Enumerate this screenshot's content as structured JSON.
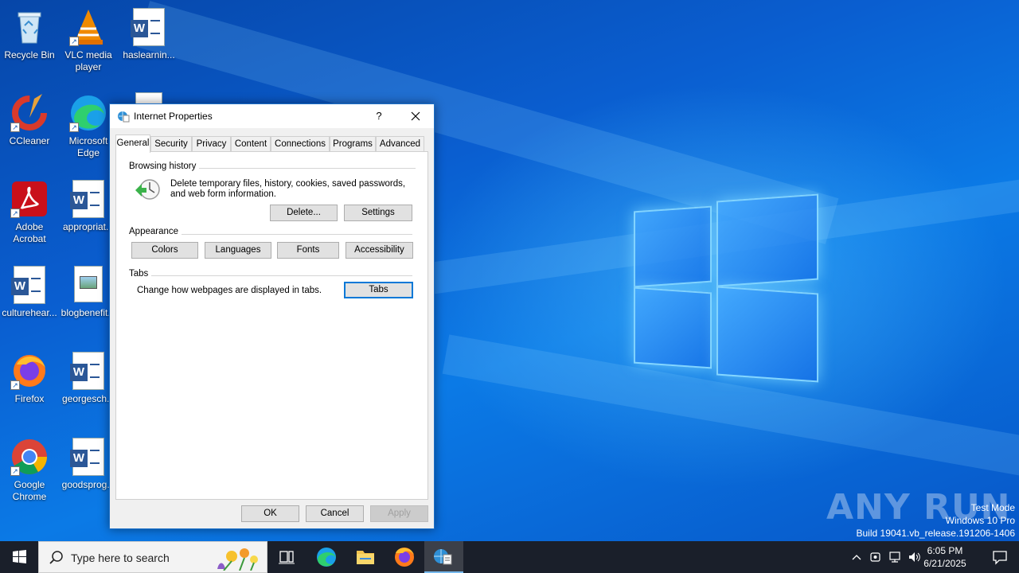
{
  "desktop": {
    "icons": [
      {
        "label": "Recycle Bin"
      },
      {
        "label": "VLC media player"
      },
      {
        "label": "haslearnin..."
      },
      {
        "label": "CCleaner"
      },
      {
        "label": "Microsoft Edge"
      },
      {
        "label": "Adobe Acrobat"
      },
      {
        "label": "appropriat..."
      },
      {
        "label": "culturehear..."
      },
      {
        "label": "blogbenefit..."
      },
      {
        "label": "Firefox"
      },
      {
        "label": "georgesch..."
      },
      {
        "label": "Google Chrome"
      },
      {
        "label": "goodsprog..."
      }
    ]
  },
  "dialog": {
    "title": "Internet Properties",
    "help": "?",
    "close": "✕",
    "tabs": [
      "General",
      "Security",
      "Privacy",
      "Content",
      "Connections",
      "Programs",
      "Advanced"
    ],
    "active_tab": "General",
    "browsing_history": {
      "label": "Browsing history",
      "description": "Delete temporary files, history, cookies, saved passwords, and web form information.",
      "delete_button": "Delete...",
      "settings_button": "Settings"
    },
    "appearance": {
      "label": "Appearance",
      "colors_button": "Colors",
      "languages_button": "Languages",
      "fonts_button": "Fonts",
      "accessibility_button": "Accessibility"
    },
    "tabs_group": {
      "label": "Tabs",
      "description": "Change how webpages are displayed in tabs.",
      "tabs_button": "Tabs"
    },
    "ok_button": "OK",
    "cancel_button": "Cancel",
    "apply_button": "Apply"
  },
  "watermark": {
    "brand": "ANY RUN",
    "line1": "Test Mode",
    "line2": "Windows 10 Pro",
    "line3": "Build 19041.vb_release.191206-1406"
  },
  "taskbar": {
    "search_placeholder": "Type here to search",
    "time": "6:05 PM",
    "date": "6/21/2025"
  },
  "colors": {
    "accent": "#0078d7",
    "taskbar": "#1a1f2a",
    "wallpaper": "#0a5fc4"
  }
}
